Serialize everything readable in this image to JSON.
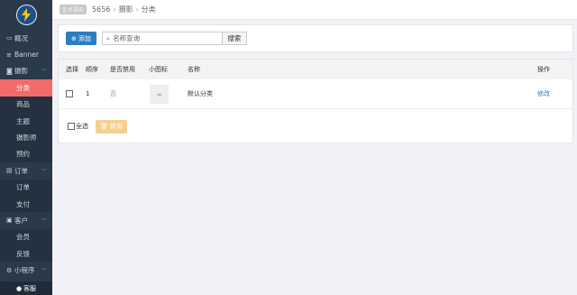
{
  "sidebar": {
    "items": [
      {
        "label": "概况",
        "icon": "desktop-icon"
      },
      {
        "label": "Banner",
        "icon": "list-icon"
      },
      {
        "label": "摄影",
        "icon": "camera-icon",
        "expanded": true
      },
      {
        "label": "分类",
        "sub": true,
        "active": true
      },
      {
        "label": "商品",
        "sub": true
      },
      {
        "label": "主题",
        "sub": true
      },
      {
        "label": "摄影师",
        "sub": true
      },
      {
        "label": "预约",
        "sub": true
      },
      {
        "label": "订单",
        "icon": "file-icon",
        "expanded": true
      },
      {
        "label": "订单",
        "sub": true
      },
      {
        "label": "支付",
        "sub": true
      },
      {
        "label": "客户",
        "icon": "id-card-icon",
        "expanded": true
      },
      {
        "label": "会员",
        "sub": true
      },
      {
        "label": "反馈",
        "sub": true
      },
      {
        "label": "小程序",
        "icon": "cogs-icon",
        "expanded": true
      }
    ],
    "user": "客服"
  },
  "breadcrumb": {
    "badge": "艺术摄影",
    "items": [
      "5656",
      "摄影",
      "分类"
    ]
  },
  "toolbar": {
    "add_label": "添加",
    "search_placeholder": "名称查询",
    "search_button": "搜索"
  },
  "table": {
    "headers": [
      "选择",
      "顺序",
      "是否禁用",
      "小图标",
      "名称",
      "操作"
    ],
    "rows": [
      {
        "order": "1",
        "disabled": "否",
        "name": "默认分类",
        "action": "修改"
      }
    ]
  },
  "footer": {
    "select_all": "全选",
    "disable_button": "禁用"
  },
  "colors": {
    "sidebar_bg": "#2b3a4a",
    "active_item": "#f36a6a",
    "primary": "#2d7dc1",
    "warning": "#f5cf8e"
  }
}
